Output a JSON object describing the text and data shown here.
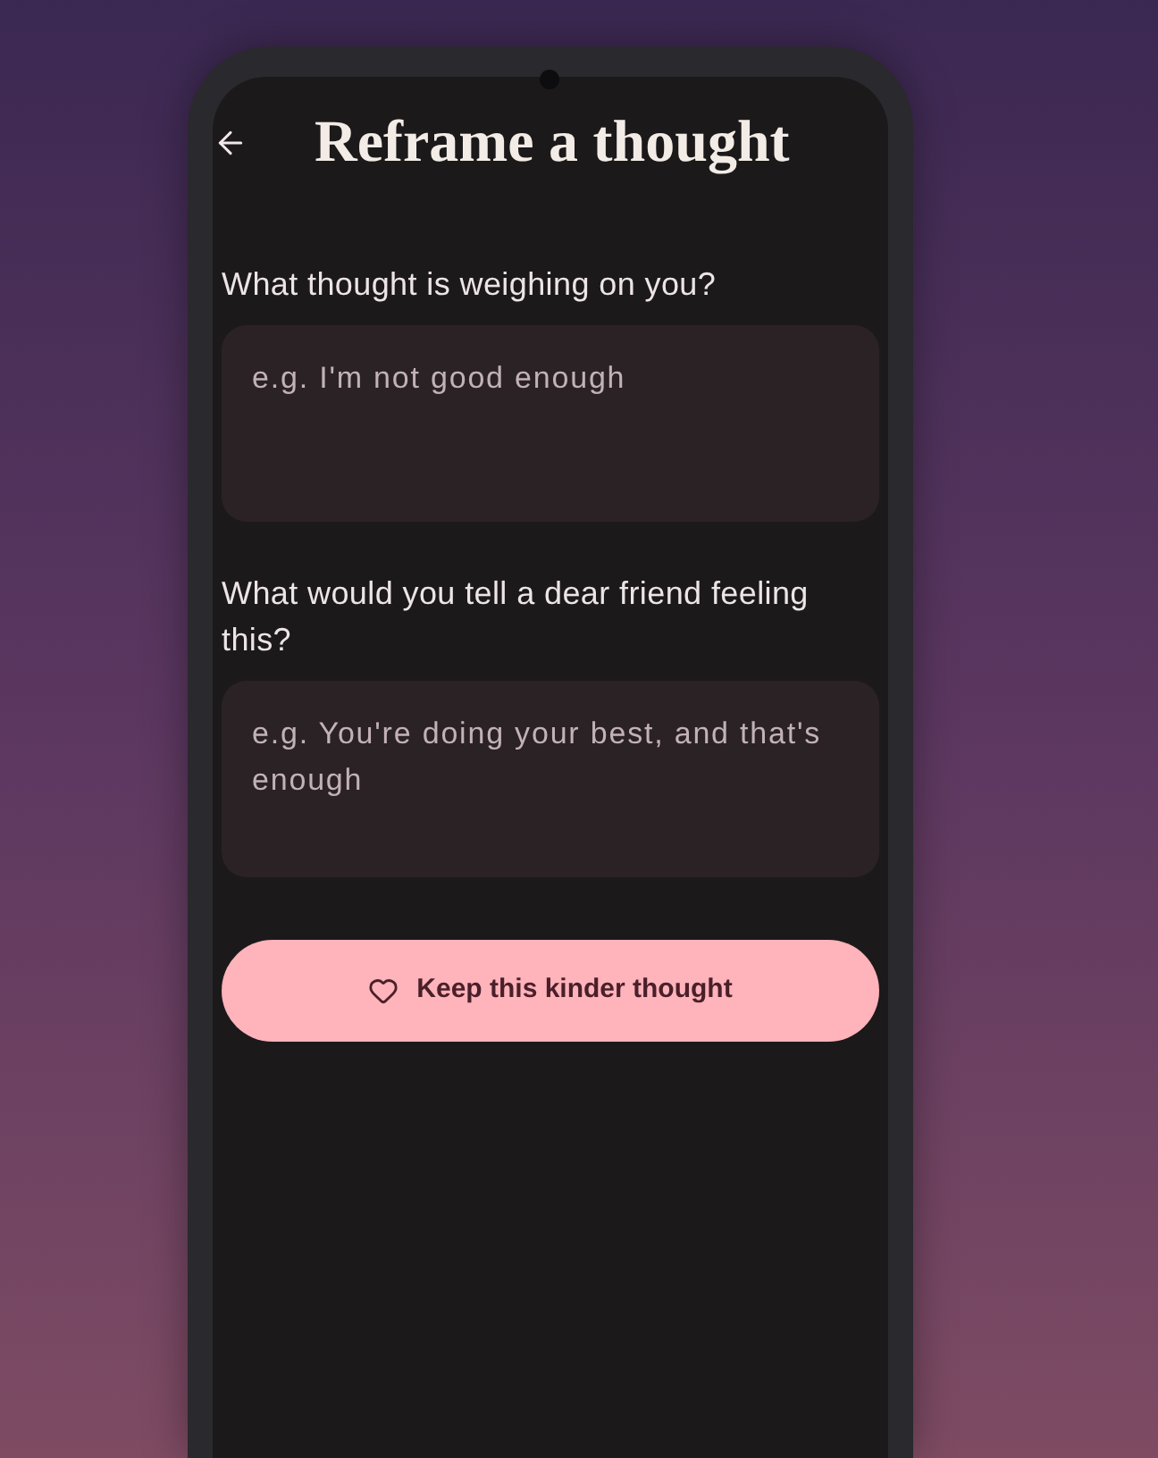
{
  "header": {
    "title": "Reframe a thought"
  },
  "fields": [
    {
      "label": "What thought is weighing on you?",
      "placeholder": "e.g. I'm not good enough"
    },
    {
      "label": "What would you tell a dear friend feeling this?",
      "placeholder": "e.g. You're doing your best, and that's enough"
    }
  ],
  "primary_button": {
    "label": "Keep this kinder thought"
  }
}
